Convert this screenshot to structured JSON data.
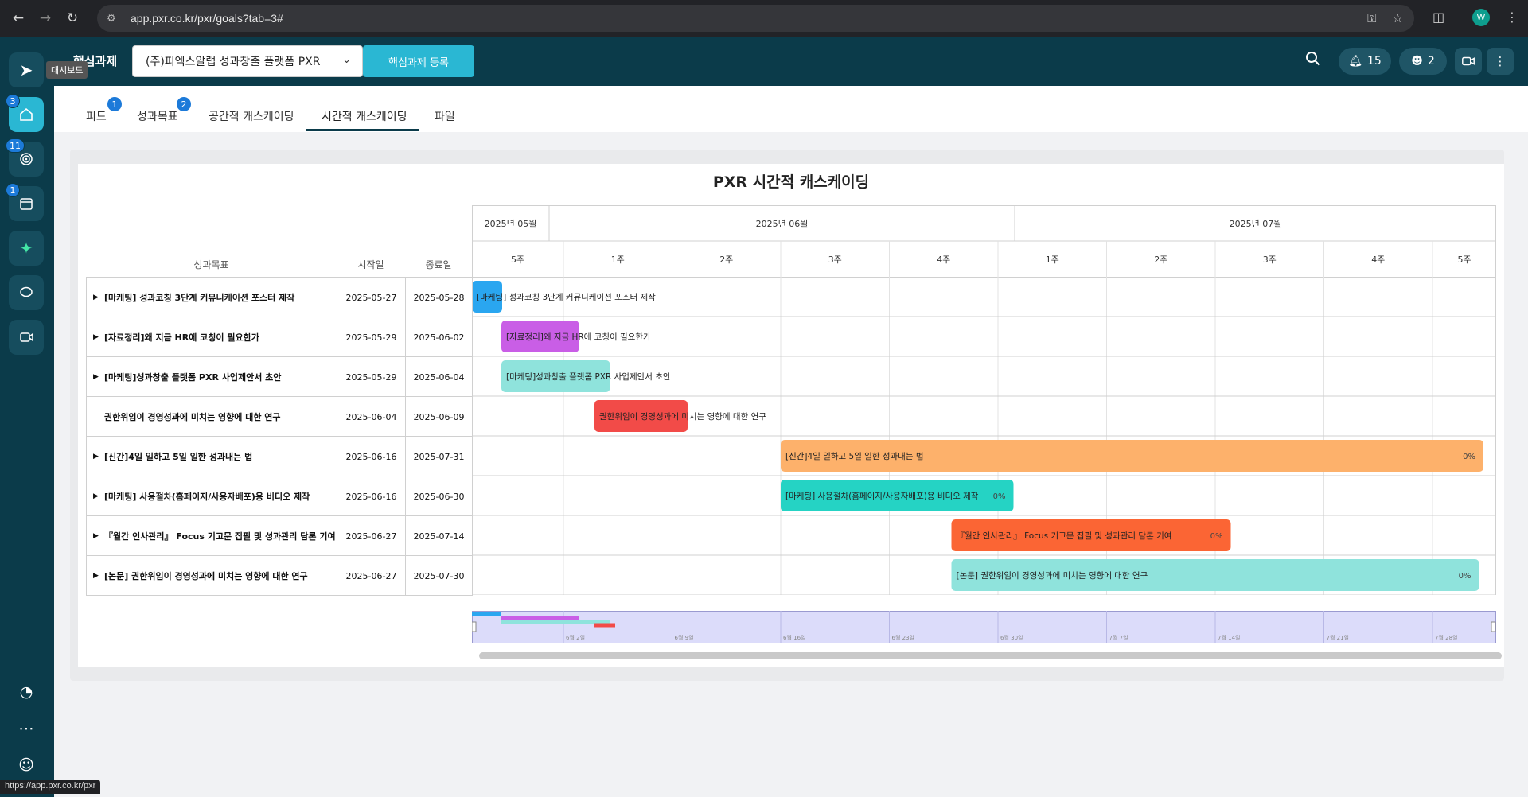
{
  "browser": {
    "url": "app.pxr.co.kr/pxr/goals?tab=3#",
    "profile_initial": "W",
    "status_url": "https://app.pxr.co.kr/pxr"
  },
  "sidebar": {
    "tooltip": "대시보드",
    "badges": [
      "3",
      "11",
      "1"
    ]
  },
  "header": {
    "title": "핵심과제",
    "org_select": "(주)피엑스알랩 성과창출 플랫폼 PXR",
    "register_label": "핵심과제 등록",
    "notifications": "15",
    "users": "2"
  },
  "tabs": [
    {
      "label": "피드",
      "badge": "1"
    },
    {
      "label": "성과목표",
      "badge": "2"
    },
    {
      "label": "공간적 캐스케이딩",
      "badge": ""
    },
    {
      "label": "시간적 캐스케이딩",
      "badge": ""
    },
    {
      "label": "파일",
      "badge": ""
    }
  ],
  "gantt": {
    "title": "PXR 시간적 캐스케이딩",
    "col_goal": "성과목표",
    "col_start": "시작일",
    "col_end": "종료일",
    "months": [
      {
        "label": "2025년 05월",
        "weeks": 1
      },
      {
        "label": "2025년 06월",
        "weeks": 4.3
      },
      {
        "label": "2025년 07월",
        "weeks": 4.5
      }
    ],
    "weeks": [
      "5주",
      "1주",
      "2주",
      "3주",
      "4주",
      "1주",
      "2주",
      "3주",
      "4주",
      "5주"
    ],
    "minimap_ticks": [
      "6월 2일",
      "6월 9일",
      "6월 16일",
      "6월 23일",
      "6월 30일",
      "7월 7일",
      "7월 14일",
      "7월 21일",
      "7월 28일"
    ],
    "rows": [
      {
        "name": "[마케팅] 성과코칭 3단계 커뮤니케이션 포스터 제작",
        "start": "2025-05-27",
        "end": "2025-05-28",
        "expand": true,
        "bar_label": "[마케팅] 성과코칭 3단계 커뮤니케이션 포스터 제작",
        "color": "#2aa6f0",
        "percent": ""
      },
      {
        "name": "[자료정리]왜 지금 HR에 코칭이 필요한가",
        "start": "2025-05-29",
        "end": "2025-06-02",
        "expand": true,
        "bar_label": "[자료정리]왜 지금 HR에 코칭이 필요한가",
        "color": "#c95ee6",
        "percent": ""
      },
      {
        "name": "[마케팅]성과창출 플랫폼 PXR 사업제안서 초안",
        "start": "2025-05-29",
        "end": "2025-06-04",
        "expand": true,
        "bar_label": "[마케팅]성과창출 플랫폼 PXR 사업제안서 초안",
        "color": "#8fe3dc",
        "percent": ""
      },
      {
        "name": "권한위임이 경영성과에 미치는 영향에 대한 연구",
        "start": "2025-06-04",
        "end": "2025-06-09",
        "expand": false,
        "bar_label": "권한위임이 경영성과에 미치는 영향에 대한 연구",
        "color": "#f24b48",
        "percent": ""
      },
      {
        "name": "[신간]4일 일하고 5일 일한 성과내는 법",
        "start": "2025-06-16",
        "end": "2025-07-31",
        "expand": true,
        "bar_label": "[신간]4일 일하고 5일 일한 성과내는 법",
        "color": "#fdb16b",
        "percent": "0%"
      },
      {
        "name": "[마케팅] 사용절차(홈페이지/사용자배포)용 비디오 제작",
        "start": "2025-06-16",
        "end": "2025-06-30",
        "expand": true,
        "bar_label": "[마케팅] 사용절차(홈페이지/사용자배포)용 비디오 제작",
        "color": "#25d3c4",
        "percent": "0%"
      },
      {
        "name": "『월간 인사관리』 Focus 기고문 집필 및 성과관리 담론 기여",
        "start": "2025-06-27",
        "end": "2025-07-14",
        "expand": true,
        "bar_label": "『월간 인사관리』 Focus 기고문 집필 및 성과관리 담론 기여",
        "color": "#fb6534",
        "percent": "0%"
      },
      {
        "name": "[논문] 권한위임이 경영성과에 미치는 영향에 대한 연구",
        "start": "2025-06-27",
        "end": "2025-07-30",
        "expand": true,
        "bar_label": "[논문] 권한위임이 경영성과에 미치는 영향에 대한 연구",
        "color": "#8fe3dc",
        "percent": "0%"
      }
    ]
  },
  "colors": {
    "sidebar_bg": "#0b3b4a",
    "accent": "#2ab7d3",
    "badge": "#1c7ad9"
  }
}
